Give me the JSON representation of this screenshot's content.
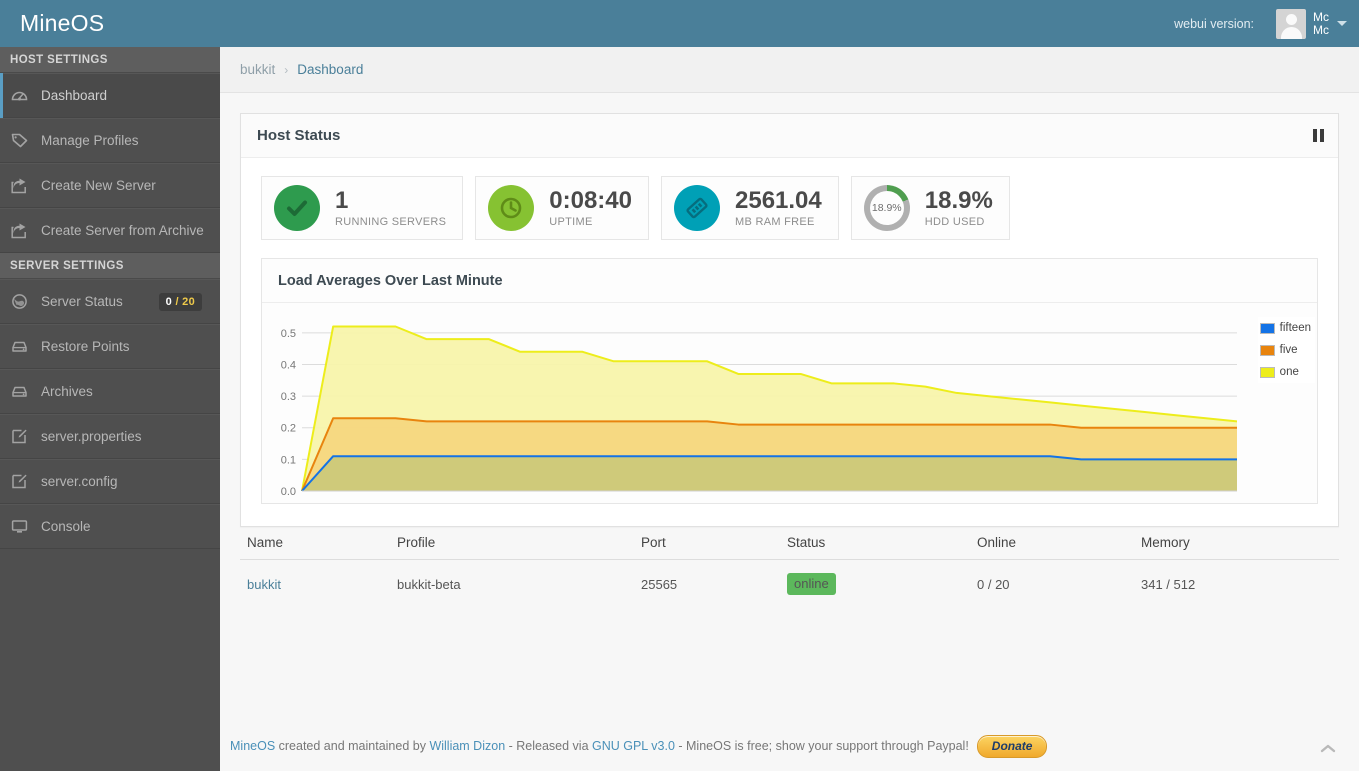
{
  "topbar": {
    "brand": "MineOS",
    "webui_version_label": "webui version:",
    "user_name": "Mc\nMc",
    "avatar_icon": "user-avatar-icon",
    "caret_icon": "chevron-down-icon"
  },
  "sidebar": {
    "sections": [
      {
        "title": "HOST SETTINGS",
        "items": [
          {
            "label": "Dashboard",
            "icon": "dashboard-icon",
            "active": true
          },
          {
            "label": "Manage Profiles",
            "icon": "tag-icon",
            "active": false
          },
          {
            "label": "Create New Server",
            "icon": "share-icon",
            "active": false
          },
          {
            "label": "Create Server from Archive",
            "icon": "share-icon",
            "active": false
          }
        ]
      },
      {
        "title": "SERVER SETTINGS",
        "items": [
          {
            "label": "Server Status",
            "icon": "globe-icon",
            "badge": "0 / 20",
            "active": false
          },
          {
            "label": "Restore Points",
            "icon": "drive-icon",
            "active": false
          },
          {
            "label": "Archives",
            "icon": "drive-icon",
            "active": false
          },
          {
            "label": "server.properties",
            "icon": "edit-icon",
            "active": false
          },
          {
            "label": "server.config",
            "icon": "edit-icon",
            "active": false
          },
          {
            "label": "Console",
            "icon": "monitor-icon",
            "active": false
          }
        ]
      }
    ]
  },
  "breadcrumb": {
    "parent": "bukkit",
    "separator": "›",
    "current": "Dashboard"
  },
  "host_status": {
    "title": "Host Status",
    "pause_icon": "pause-icon",
    "cards": [
      {
        "value": "1",
        "label": "RUNNING SERVERS",
        "icon": "check-icon",
        "color": "#2e9b4e"
      },
      {
        "value": "0:08:40",
        "label": "UPTIME",
        "icon": "clock-icon",
        "color": "#86c232"
      },
      {
        "value": "2561.04",
        "label": "MB RAM FREE",
        "icon": "memory-icon",
        "color": "#00a0b6"
      },
      {
        "value": "18.9%",
        "label": "HDD USED",
        "icon": "donut-icon",
        "donut_text": "18.9%",
        "percent": 18.9,
        "color": "#4f9e4f",
        "track": "#b0b0b0"
      }
    ]
  },
  "chart_data": {
    "type": "area",
    "title": "Load Averages Over Last Minute",
    "xlabel": "",
    "ylabel": "",
    "ylim": [
      0.0,
      0.55
    ],
    "yticks": [
      "0.0",
      "0.1",
      "0.2",
      "0.3",
      "0.4",
      "0.5"
    ],
    "ytick_values": [
      0.0,
      0.1,
      0.2,
      0.3,
      0.4,
      0.5
    ],
    "grid": true,
    "legend_position": "top-right",
    "x": [
      0,
      1,
      2,
      3,
      4,
      5,
      6,
      7,
      8,
      9,
      10,
      11,
      12,
      13,
      14,
      15,
      16,
      17,
      18,
      19,
      20,
      21,
      22,
      23,
      24,
      25,
      26,
      27,
      28,
      29,
      30
    ],
    "series": [
      {
        "name": "one",
        "color": "#eded1b",
        "fill": "#f7f4a8",
        "values": [
          0.0,
          0.52,
          0.52,
          0.52,
          0.48,
          0.48,
          0.48,
          0.44,
          0.44,
          0.44,
          0.41,
          0.41,
          0.41,
          0.41,
          0.37,
          0.37,
          0.37,
          0.34,
          0.34,
          0.34,
          0.33,
          0.31,
          0.3,
          0.29,
          0.28,
          0.27,
          0.26,
          0.25,
          0.24,
          0.23,
          0.22
        ]
      },
      {
        "name": "five",
        "color": "#e8840e",
        "fill": "#f5d67e",
        "values": [
          0.0,
          0.23,
          0.23,
          0.23,
          0.22,
          0.22,
          0.22,
          0.22,
          0.22,
          0.22,
          0.22,
          0.22,
          0.22,
          0.22,
          0.21,
          0.21,
          0.21,
          0.21,
          0.21,
          0.21,
          0.21,
          0.21,
          0.21,
          0.21,
          0.21,
          0.2,
          0.2,
          0.2,
          0.2,
          0.2,
          0.2
        ]
      },
      {
        "name": "fifteen",
        "color": "#1473e6",
        "fill": "#cbc97a",
        "values": [
          0.0,
          0.11,
          0.11,
          0.11,
          0.11,
          0.11,
          0.11,
          0.11,
          0.11,
          0.11,
          0.11,
          0.11,
          0.11,
          0.11,
          0.11,
          0.11,
          0.11,
          0.11,
          0.11,
          0.11,
          0.11,
          0.11,
          0.11,
          0.11,
          0.11,
          0.1,
          0.1,
          0.1,
          0.1,
          0.1,
          0.1
        ]
      }
    ],
    "legend": [
      {
        "name": "fifteen",
        "color": "#1473e6"
      },
      {
        "name": "five",
        "color": "#e8840e"
      },
      {
        "name": "one",
        "color": "#eded1b"
      }
    ]
  },
  "servers_table": {
    "columns": [
      "Name",
      "Profile",
      "Port",
      "Status",
      "Online",
      "Memory"
    ],
    "rows": [
      {
        "name": "bukkit",
        "profile": "bukkit-beta",
        "port": "25565",
        "status": "online",
        "online": "0 / 20",
        "memory": "341 / 512"
      }
    ]
  },
  "footer": {
    "link_mineos": "MineOS",
    "text_1": " created and maintained by ",
    "link_author": "William Dizon",
    "text_2": " - Released via ",
    "link_license": "GNU GPL v3.0",
    "text_3": " - MineOS is free; show your support through Paypal!",
    "donate_label": "Donate",
    "to_top_icon": "chevron-up-icon"
  }
}
